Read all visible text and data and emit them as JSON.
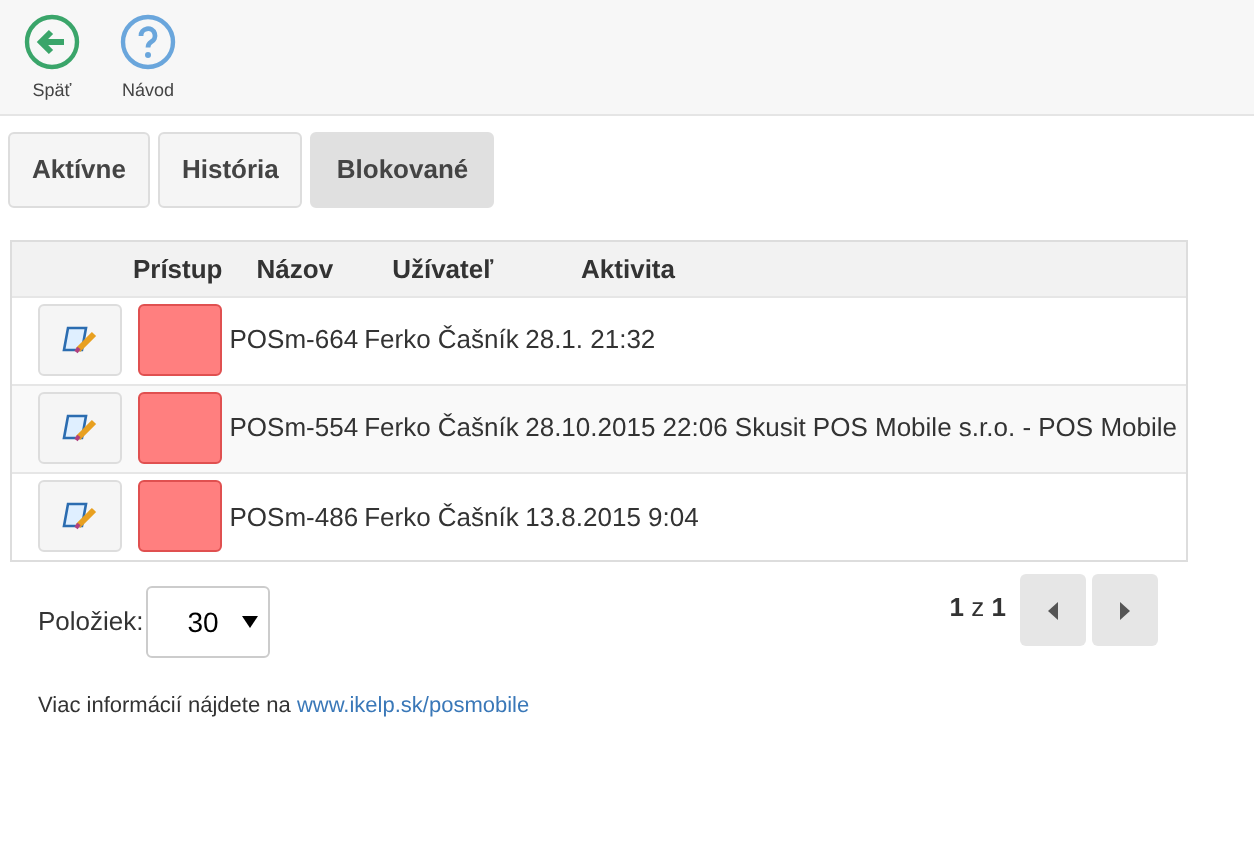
{
  "toolbar": [
    {
      "kind": "back",
      "label": "Späť"
    },
    {
      "kind": "help",
      "label": "Návod"
    }
  ],
  "tabs": [
    {
      "label": "Aktívne",
      "selected": false
    },
    {
      "label": "História",
      "selected": false
    },
    {
      "label": "Blokované",
      "selected": true
    }
  ],
  "table": {
    "columns": [
      "Prístup",
      "Názov",
      "Užívateľ",
      "Aktivita"
    ],
    "rows": [
      {
        "color": "#ff7f7f",
        "name": "POSm-664",
        "user": "Ferko Čašník",
        "activity": "28.1. 21:32"
      },
      {
        "color": "#ff7f7f",
        "name": "POSm-554",
        "user": "Ferko Čašník",
        "activity": "28.10.2015 22:06",
        "column_5": "Skusit POS Mobile s.r.o. - POS Mobile"
      },
      {
        "color": "#ff7f7f",
        "name": "POSm-486",
        "user": "Ferko Čašník",
        "activity": "13.8.2015 9:04"
      }
    ]
  },
  "page_size": {
    "label": "Položiek:",
    "value": "30"
  },
  "pager": {
    "current": "1",
    "separator": "z",
    "total": "1"
  },
  "info": {
    "text": "Viac informácií nájdete na",
    "link": "www.ikelp.sk/posmobile"
  }
}
